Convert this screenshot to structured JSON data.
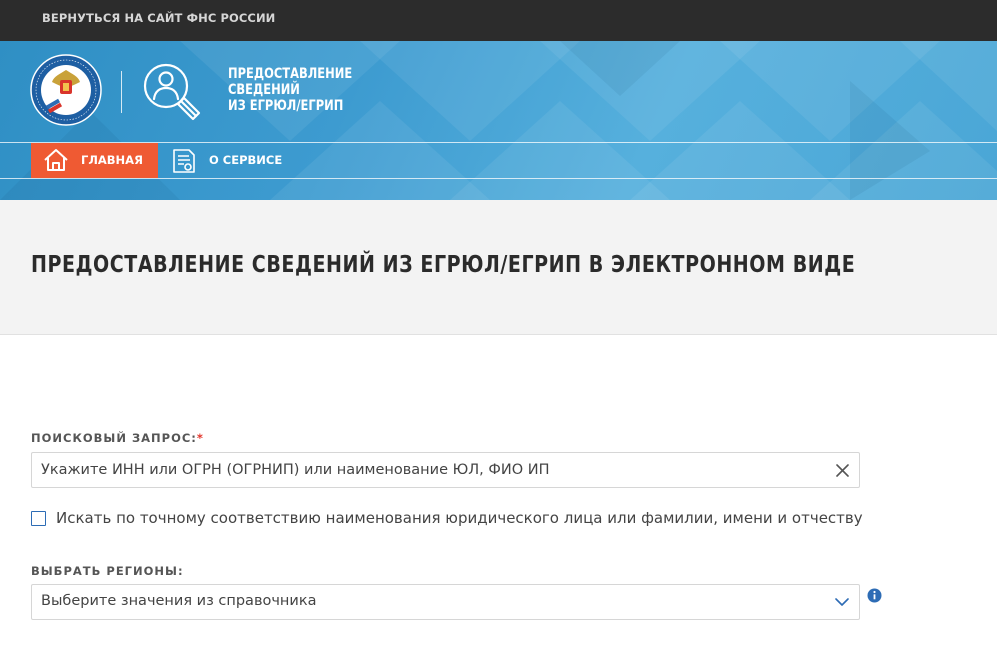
{
  "topbar": {
    "back_link": "ВЕРНУТЬСЯ НА САЙТ ФНС РОССИИ"
  },
  "header": {
    "emblem_icon": "fns-emblem-icon",
    "emblem_text": "ФЕДЕРАЛЬНАЯ НАЛОГОВАЯ СЛУЖБА",
    "service_icon": "person-magnifier-icon",
    "service_title_lines": [
      "ПРЕДОСТАВЛЕНИЕ",
      "СВЕДЕНИЙ",
      "ИЗ ЕГРЮЛ/ЕГРИП"
    ]
  },
  "nav": {
    "home": {
      "label": "ГЛАВНАЯ",
      "icon": "home-icon",
      "active": true
    },
    "about": {
      "label": "О СЕРВИСЕ",
      "icon": "document-icon"
    }
  },
  "page_title": "ПРЕДОСТАВЛЕНИЕ СВЕДЕНИЙ ИЗ ЕГРЮЛ/ЕГРИП В ЭЛЕКТРОННОМ ВИДЕ",
  "search": {
    "label": "ПОИСКОВЫЙ ЗАПРОС:",
    "required_mark": "*",
    "placeholder": "Укажите ИНН или ОГРН (ОГРНИП) или наименование ЮЛ, ФИО ИП",
    "value": "",
    "clear_icon": "close-icon"
  },
  "exact_match": {
    "label": "Искать по точному соответствию наименования юридического лица или фамилии, имени и отчеству",
    "checked": false
  },
  "regions": {
    "label": "ВЫБРАТЬ РЕГИОНЫ:",
    "placeholder": "Выберите значения из справочника",
    "dropdown_icon": "chevron-down-icon",
    "info_icon": "info-icon"
  },
  "colors": {
    "topbar_bg": "#2c2c2c",
    "banner_blue": "#3d9bd0",
    "accent_orange": "#ef5a33",
    "required_red": "#e2352b",
    "checkbox_blue": "#2d6cb5",
    "info_blue": "#2d6cb5"
  }
}
